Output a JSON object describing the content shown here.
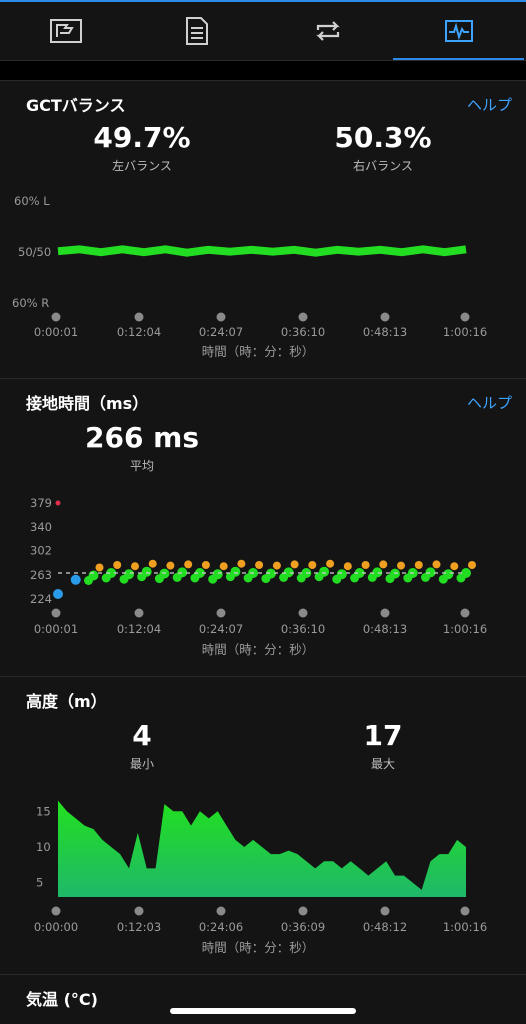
{
  "tabs": [
    {
      "icon": "laps-flag-icon"
    },
    {
      "icon": "summary-list-icon"
    },
    {
      "icon": "repeat-icon"
    },
    {
      "icon": "charts-icon",
      "active": true
    }
  ],
  "gct_balance": {
    "title": "GCTバランス",
    "help": "ヘルプ",
    "left_value": "49.7%",
    "left_label": "左バランス",
    "right_value": "50.3%",
    "right_label": "右バランス",
    "y_labels": [
      "60% L",
      "50/50",
      "60% R"
    ],
    "x_labels": [
      "0:00:01",
      "0:12:04",
      "0:24:07",
      "0:36:10",
      "0:48:13",
      "1:00:16"
    ],
    "x_axis_title": "時間（時：分：秒）"
  },
  "ground_contact": {
    "title": "接地時間（ms）",
    "help": "ヘルプ",
    "value": "266 ms",
    "value_label": "平均",
    "y_labels": [
      "379",
      "340",
      "302",
      "263",
      "224"
    ],
    "x_labels": [
      "0:00:01",
      "0:12:04",
      "0:24:07",
      "0:36:10",
      "0:48:13",
      "1:00:16"
    ],
    "x_axis_title": "時間（時：分：秒）"
  },
  "elevation": {
    "title": "高度（m）",
    "min_value": "4",
    "min_label": "最小",
    "max_value": "17",
    "max_label": "最大",
    "y_labels": [
      "15",
      "10",
      "5"
    ],
    "x_labels": [
      "0:00:00",
      "0:12:03",
      "0:24:06",
      "0:36:09",
      "0:48:12",
      "1:00:16"
    ],
    "x_axis_title": "時間（時：分：秒）"
  },
  "temperature": {
    "title": "気温 (°C)"
  },
  "colors": {
    "accent": "#2b8be6",
    "green": "#22dd22",
    "orange": "#f0a020",
    "blue": "#2a9be8",
    "red": "#e0304a",
    "link": "#3ea3ff"
  },
  "chart_data": [
    {
      "type": "line",
      "title": "GCTバランス",
      "xlabel": "時間（時：分：秒）",
      "x_ticks": [
        "0:00:01",
        "0:12:04",
        "0:24:07",
        "0:36:10",
        "0:48:13",
        "1:00:16"
      ],
      "y_ticks": [
        "60% L",
        "50/50",
        "60% R"
      ],
      "series": [
        {
          "values": [
            50.4,
            50.3,
            50.2,
            50.3,
            50.2,
            50.3,
            50.1,
            50.2,
            50.3,
            50.2,
            50.3,
            50.2,
            50.1,
            50.2,
            50.3,
            50.2,
            50.2,
            50.3,
            50.2,
            50.3
          ]
        }
      ],
      "ylim": [
        40,
        60
      ]
    },
    {
      "type": "scatter",
      "title": "接地時間（ms）",
      "xlabel": "時間（時：分：秒）",
      "x_ticks": [
        "0:00:01",
        "0:12:04",
        "0:24:07",
        "0:36:10",
        "0:48:13",
        "1:00:16"
      ],
      "y_ticks": [
        379,
        340,
        302,
        263,
        224
      ],
      "ylim": [
        224,
        379
      ],
      "average": 266,
      "series": [
        {
          "values": [
            232,
            255,
            262,
            266,
            264,
            268,
            265,
            267,
            266,
            264,
            268,
            266,
            265,
            267,
            266,
            268,
            264,
            266,
            267,
            265,
            266,
            267,
            264,
            266
          ]
        }
      ]
    },
    {
      "type": "area",
      "title": "高度（m）",
      "xlabel": "時間（時：分：秒）",
      "x_ticks": [
        "0:00:00",
        "0:12:03",
        "0:24:06",
        "0:36:09",
        "0:48:12",
        "1:00:16"
      ],
      "y_ticks": [
        15,
        10,
        5
      ],
      "ylim": [
        3,
        17
      ],
      "series": [
        {
          "values": [
            16.5,
            15,
            14,
            13,
            12.5,
            11,
            10,
            9,
            7,
            12,
            7,
            7,
            16,
            15,
            15,
            13,
            15,
            14,
            15,
            13,
            11,
            10,
            11,
            10,
            9,
            9,
            9.5,
            9,
            8,
            7,
            8,
            8,
            7,
            8,
            7,
            6,
            7,
            8,
            6,
            6,
            5,
            4,
            8,
            9,
            9,
            11,
            10
          ]
        }
      ]
    }
  ]
}
